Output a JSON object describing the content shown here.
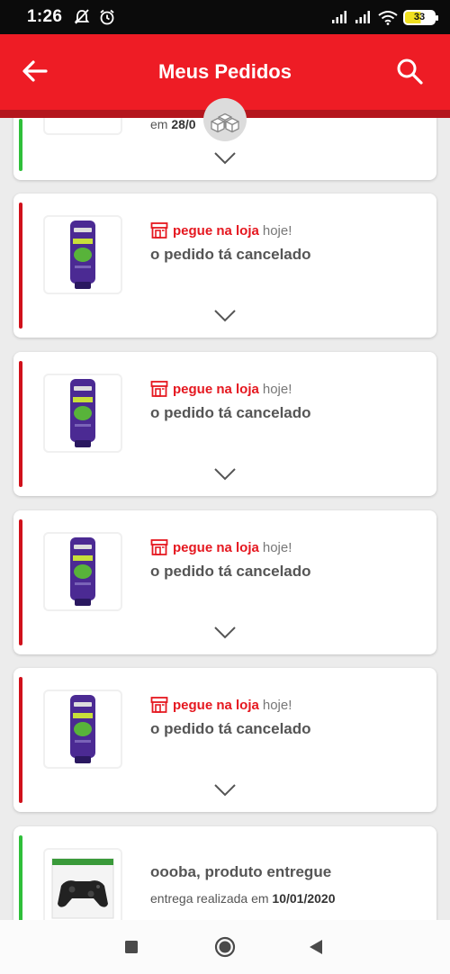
{
  "status_bar": {
    "time": "1:26",
    "battery": "33"
  },
  "header": {
    "title": "Meus Pedidos"
  },
  "orders": [
    {
      "status_color": "#2fbf3a",
      "date_prefix": "em",
      "date": "28/0"
    },
    {
      "status_color": "#d0111b",
      "pickup_label": "pegue na loja",
      "pickup_when": "hoje!",
      "status": "o pedido tá cancelado"
    },
    {
      "status_color": "#d0111b",
      "pickup_label": "pegue na loja",
      "pickup_when": "hoje!",
      "status": "o pedido tá cancelado"
    },
    {
      "status_color": "#d0111b",
      "pickup_label": "pegue na loja",
      "pickup_when": "hoje!",
      "status": "o pedido tá cancelado"
    },
    {
      "status_color": "#d0111b",
      "pickup_label": "pegue na loja",
      "pickup_when": "hoje!",
      "status": "o pedido tá cancelado"
    },
    {
      "status_color": "#2fbf3a",
      "status": "oooba, produto entregue",
      "delivery_prefix": "entrega realizada em",
      "delivery_date": "10/01/2020"
    }
  ],
  "icons": {
    "back": "arrow-left-icon",
    "search": "search-icon",
    "store": "store-icon",
    "chevron": "chevron-down-icon",
    "badge": "boxes-icon"
  },
  "colors": {
    "brand_red": "#ee1c25",
    "cancelled": "#d0111b",
    "delivered": "#2fbf3a"
  }
}
